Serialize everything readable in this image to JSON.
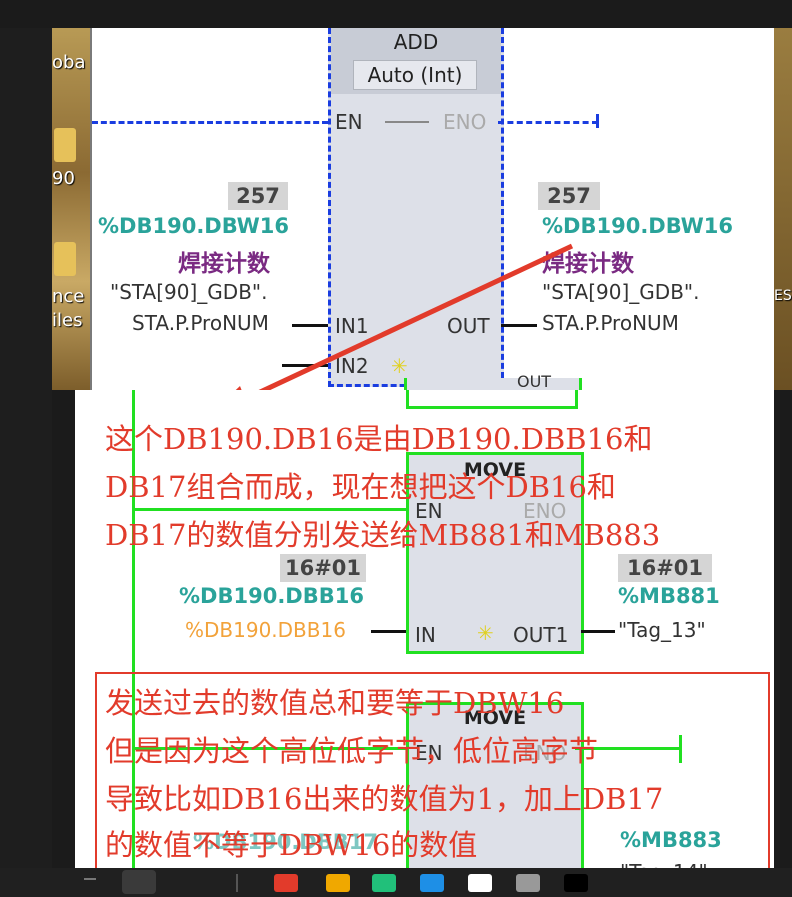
{
  "add_block": {
    "title": "ADD",
    "type": "Auto (Int)",
    "en": "EN",
    "eno": "ENO",
    "in1": "IN1",
    "in2": "IN2",
    "out": "OUT",
    "in1_value": "257",
    "in1_address": "%DB190.DBW16",
    "in1_comment": "焊接计数",
    "in1_symbol_1": "\"STA[90]_GDB\".",
    "in1_symbol_2": "STA.P.ProNUM",
    "out_value": "257",
    "out_address": "%DB190.DBW16",
    "out_comment": "焊接计数",
    "out_symbol_1": "\"STA[90]_GDB\".",
    "out_symbol_2": "STA.P.ProNUM",
    "partial_out": "OUT"
  },
  "move_block_1": {
    "title": "MOVE",
    "en": "EN",
    "eno": "ENO",
    "in": "IN",
    "out1": "OUT1",
    "in_value": "16#01",
    "in_address": "%DB190.DBB16",
    "in_symbol": "%DB190.DBB16",
    "out_value": "16#01",
    "out_address": "%MB881",
    "out_tag": "\"Tag_13\""
  },
  "move_block_2": {
    "title": "MOVE",
    "en": "EN",
    "eno": "ENO",
    "out_address": "%MB883",
    "out_tag": "\"Tag_14\"",
    "in_address": "%DB190.DBB17"
  },
  "annotation_1": {
    "line1": "这个DB190.DB16是由DB190.DBB16和",
    "line2": "DB17组合而成，现在想把这个DB16和",
    "line3": "DB17的数值分别发送给MB881和MB883"
  },
  "annotation_2": {
    "line1": "发送过去的数值总和要等于DBW16",
    "line2": "但是因为这个高位低字节，低位高字节",
    "line3": "导致比如DB16出来的数值为1，加上DB17",
    "line4": "的数值不等于DBW16的数值"
  },
  "desktop": {
    "label_1": "oba",
    "label_2": "90",
    "label_3": "nce",
    "label_4": "iles",
    "right_label": "ES"
  },
  "colors": {
    "accent_red": "#e23b2b",
    "teal": "#2aa39a",
    "purple": "#7a2a82",
    "block_green": "#21e021",
    "dashed_blue": "#1a3de0"
  }
}
